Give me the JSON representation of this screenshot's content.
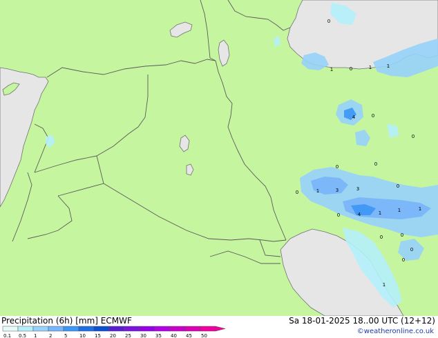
{
  "title": "Precipitation (6h) [mm] ECMWF",
  "valid_time": "Sa 18-01-2025 18..00 UTC (12+12)",
  "credit": "©weatheronline.co.uk",
  "colors": {
    "land": "#c6f5a0",
    "sea": "#e6e6e6",
    "border": "#5a5a5a",
    "coast": "#6e6e6e"
  },
  "legend": {
    "labels": [
      "0.1",
      "0.5",
      "1",
      "2",
      "5",
      "10",
      "15",
      "20",
      "25",
      "30",
      "35",
      "40",
      "45",
      "50"
    ],
    "colors": [
      "#e6fafa",
      "#b4f0fa",
      "#96d2fa",
      "#78b4fa",
      "#3c96f5",
      "#1e6ee6",
      "#0a50d2",
      "#5a1ed2",
      "#7814dc",
      "#9600e6",
      "#b400e6",
      "#c800c8",
      "#dc00b4",
      "#f000a0"
    ]
  },
  "precip_values": [
    "0",
    "1",
    "0",
    "1",
    "1",
    "4",
    "0",
    "0",
    "0",
    "0",
    "0",
    "0",
    "1",
    "3",
    "3",
    "0",
    "4",
    "1",
    "1",
    "1",
    "0",
    "0",
    "0",
    "0",
    "1"
  ]
}
